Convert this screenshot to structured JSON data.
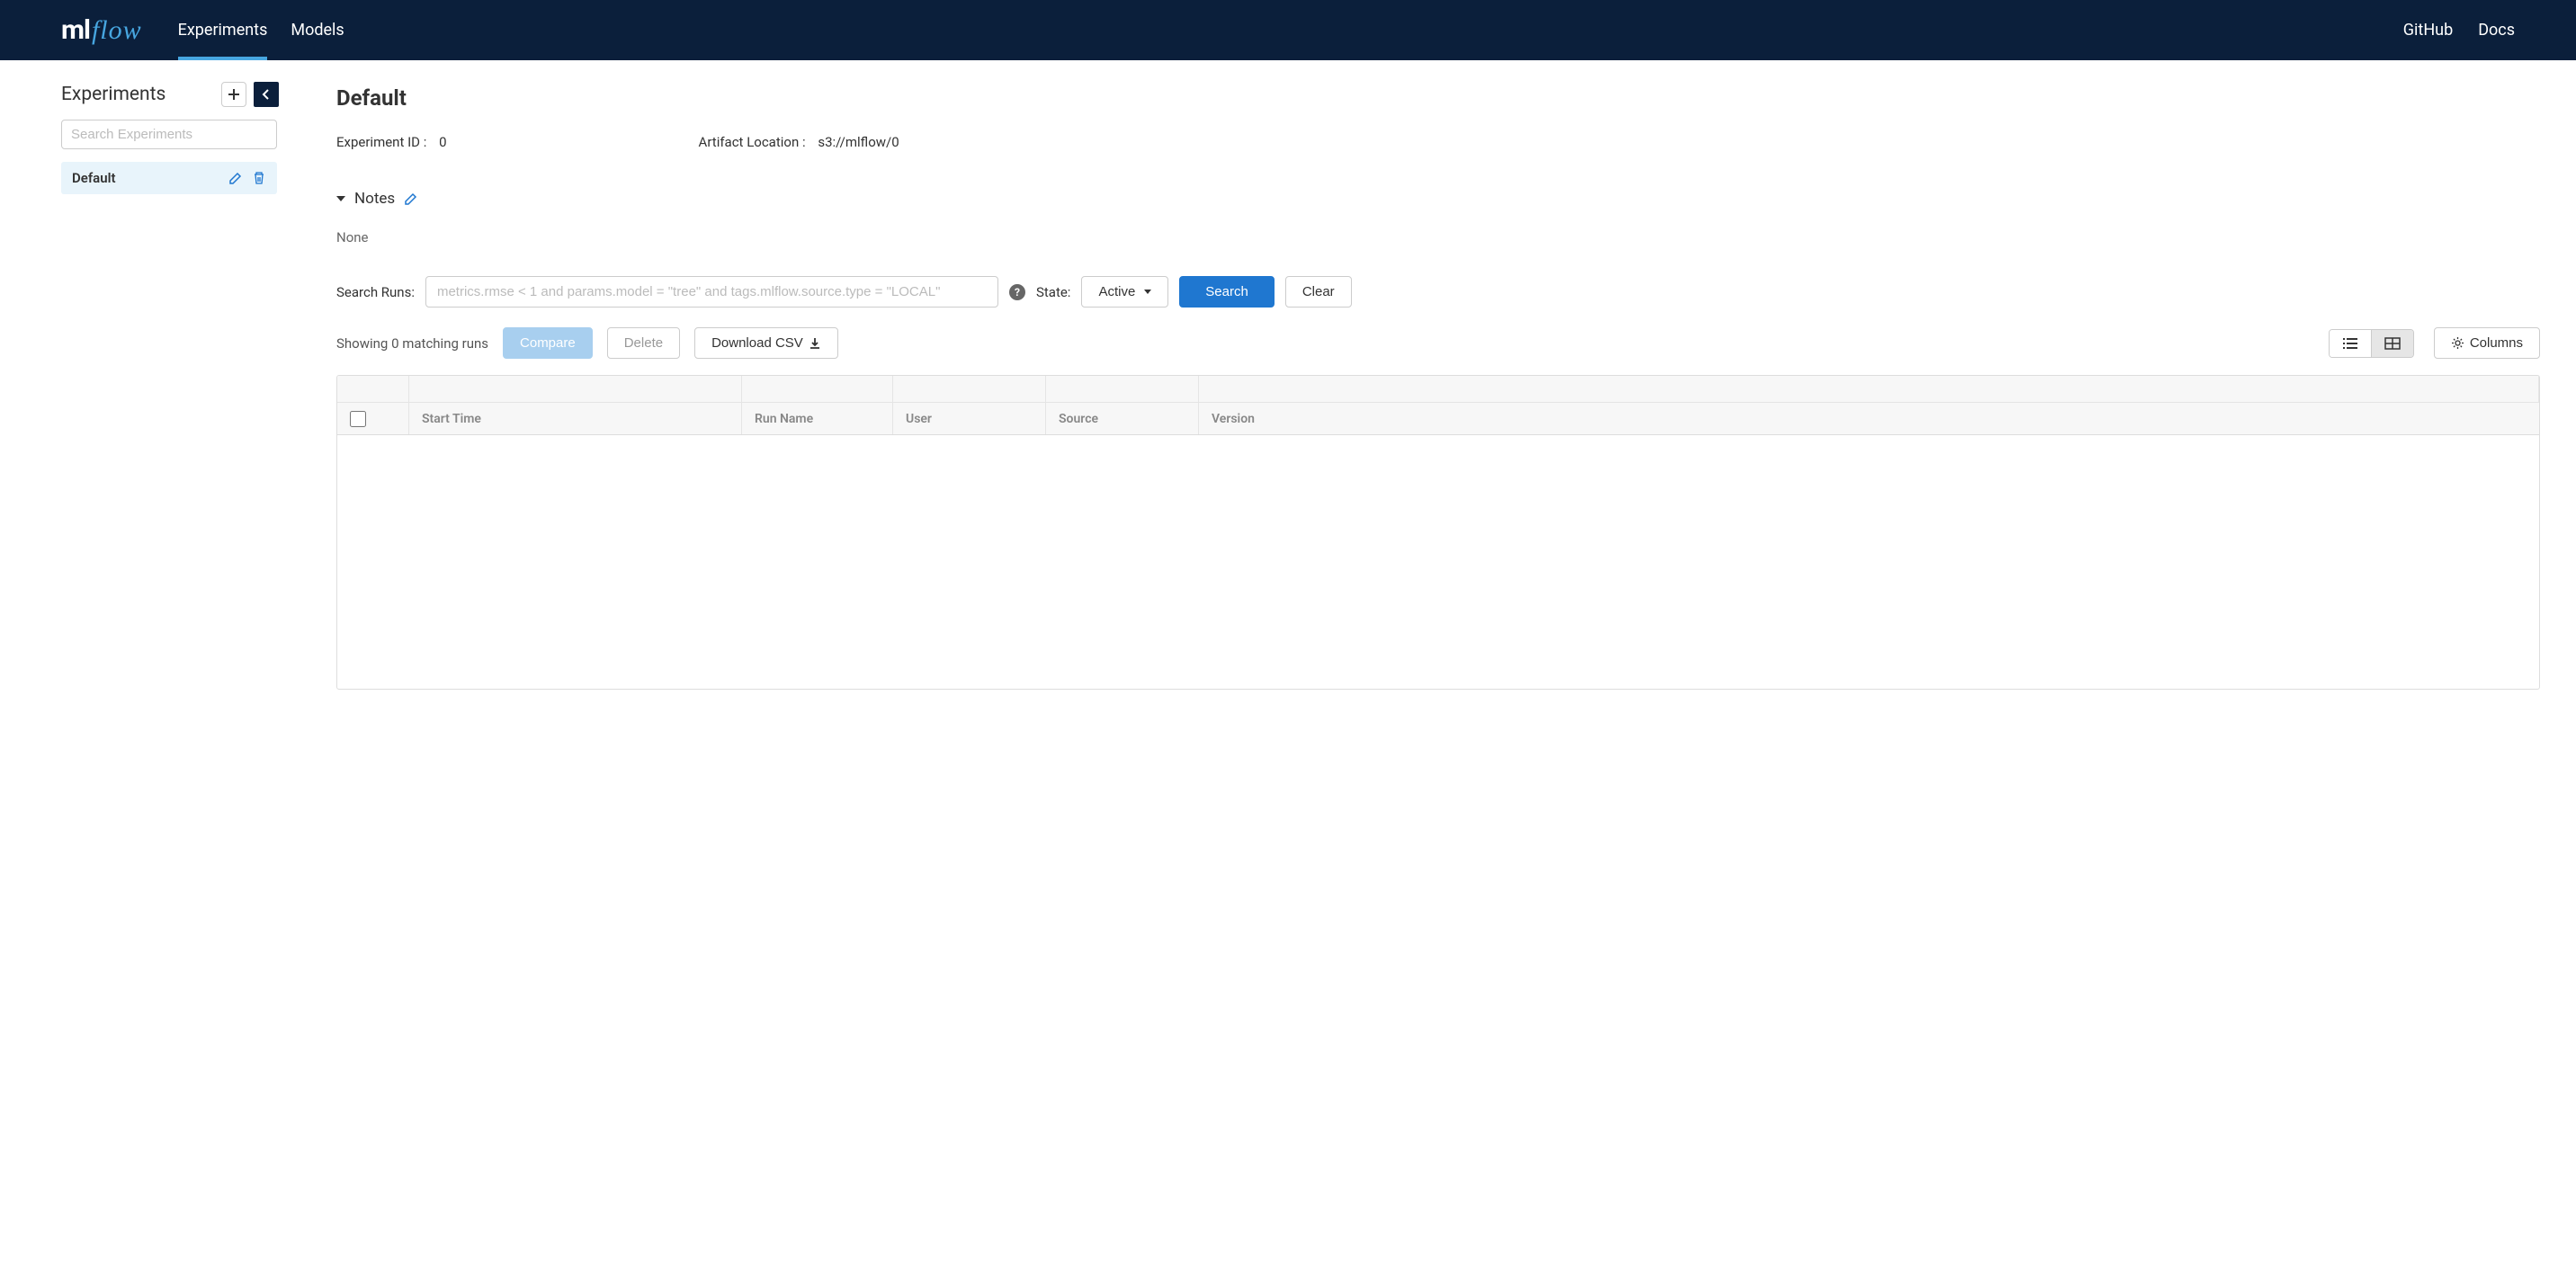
{
  "topbar": {
    "logo_ml": "ml",
    "logo_flow": "flow",
    "nav": {
      "experiments": "Experiments",
      "models": "Models"
    },
    "right": {
      "github": "GitHub",
      "docs": "Docs"
    }
  },
  "sidebar": {
    "title": "Experiments",
    "search_placeholder": "Search Experiments",
    "items": [
      {
        "label": "Default"
      }
    ]
  },
  "content": {
    "title": "Default",
    "meta": {
      "experiment_id_label": "Experiment ID :",
      "experiment_id_value": "0",
      "artifact_location_label": "Artifact Location :",
      "artifact_location_value": "s3://mlflow/0"
    },
    "notes": {
      "label": "Notes",
      "value": "None"
    },
    "search": {
      "label": "Search Runs:",
      "placeholder": "metrics.rmse < 1 and params.model = \"tree\" and tags.mlflow.source.type = \"LOCAL\"",
      "state_label": "State:",
      "state_value": "Active",
      "search_button": "Search",
      "clear_button": "Clear"
    },
    "results": {
      "summary": "Showing 0 matching runs",
      "compare_button": "Compare",
      "delete_button": "Delete",
      "download_csv_button": "Download CSV",
      "columns_button": "Columns"
    },
    "table": {
      "columns": {
        "start_time": "Start Time",
        "run_name": "Run Name",
        "user": "User",
        "source": "Source",
        "version": "Version"
      }
    }
  }
}
